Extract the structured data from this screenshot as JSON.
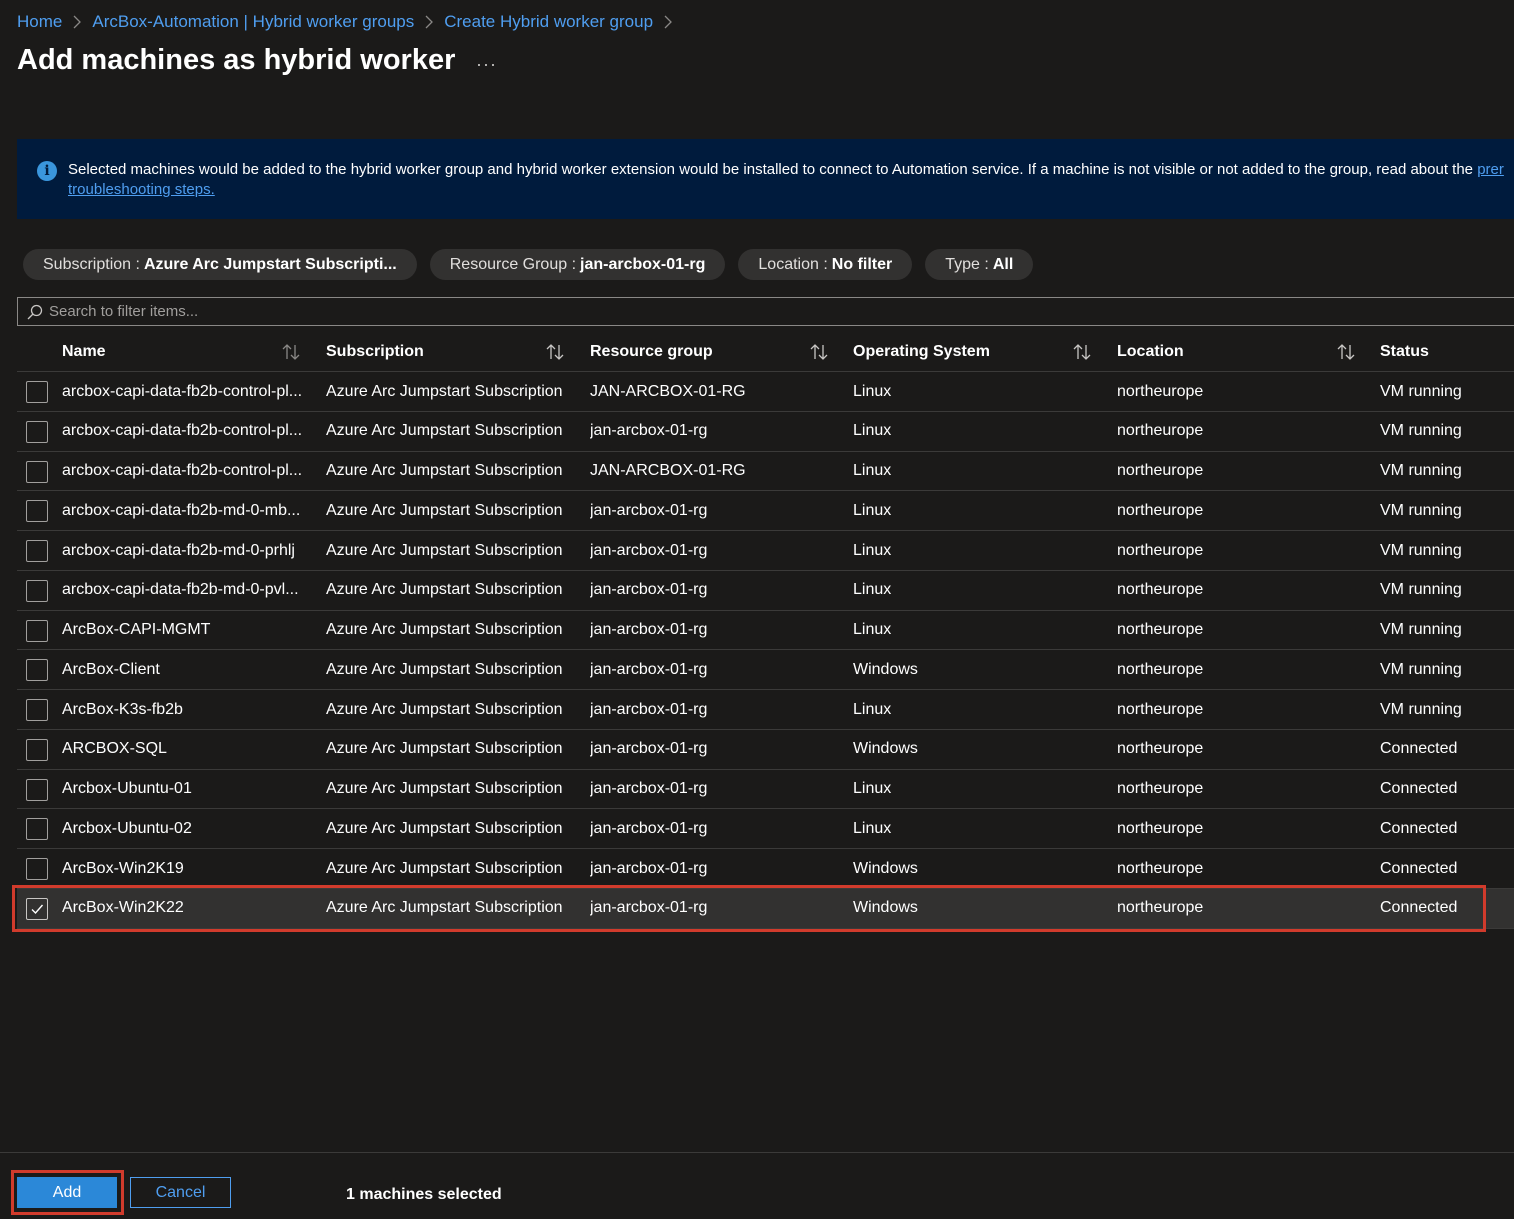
{
  "breadcrumb": [
    "Home",
    "ArcBox-Automation | Hybrid worker groups",
    "Create Hybrid worker group"
  ],
  "page": {
    "title": "Add machines as hybrid worker",
    "more": "···"
  },
  "info": {
    "text": "Selected machines would be added to the hybrid worker group and hybrid worker extension would be installed to connect to Automation service. If a machine is not visible or not added to the group, read about the ",
    "link_fragment": "prer",
    "link_line2": "troubleshooting steps."
  },
  "filters": [
    {
      "label": "Subscription :",
      "value": "Azure Arc Jumpstart Subscripti..."
    },
    {
      "label": "Resource Group :",
      "value": "jan-arcbox-01-rg"
    },
    {
      "label": "Location :",
      "value": "No filter"
    },
    {
      "label": "Type :",
      "value": "All"
    }
  ],
  "search": {
    "placeholder": "Search to filter items..."
  },
  "table": {
    "columns": [
      "Name",
      "Subscription",
      "Resource group",
      "Operating System",
      "Location",
      "Status"
    ],
    "rows": [
      {
        "name": "arcbox-capi-data-fb2b-control-pl...",
        "subscription": "Azure Arc Jumpstart Subscription",
        "resource_group": "JAN-ARCBOX-01-RG",
        "os": "Linux",
        "location": "northeurope",
        "status": "VM running",
        "checked": false
      },
      {
        "name": "arcbox-capi-data-fb2b-control-pl...",
        "subscription": "Azure Arc Jumpstart Subscription",
        "resource_group": "jan-arcbox-01-rg",
        "os": "Linux",
        "location": "northeurope",
        "status": "VM running",
        "checked": false
      },
      {
        "name": "arcbox-capi-data-fb2b-control-pl...",
        "subscription": "Azure Arc Jumpstart Subscription",
        "resource_group": "JAN-ARCBOX-01-RG",
        "os": "Linux",
        "location": "northeurope",
        "status": "VM running",
        "checked": false
      },
      {
        "name": "arcbox-capi-data-fb2b-md-0-mb...",
        "subscription": "Azure Arc Jumpstart Subscription",
        "resource_group": "jan-arcbox-01-rg",
        "os": "Linux",
        "location": "northeurope",
        "status": "VM running",
        "checked": false
      },
      {
        "name": "arcbox-capi-data-fb2b-md-0-prhlj",
        "subscription": "Azure Arc Jumpstart Subscription",
        "resource_group": "jan-arcbox-01-rg",
        "os": "Linux",
        "location": "northeurope",
        "status": "VM running",
        "checked": false
      },
      {
        "name": "arcbox-capi-data-fb2b-md-0-pvl...",
        "subscription": "Azure Arc Jumpstart Subscription",
        "resource_group": "jan-arcbox-01-rg",
        "os": "Linux",
        "location": "northeurope",
        "status": "VM running",
        "checked": false
      },
      {
        "name": "ArcBox-CAPI-MGMT",
        "subscription": "Azure Arc Jumpstart Subscription",
        "resource_group": "jan-arcbox-01-rg",
        "os": "Linux",
        "location": "northeurope",
        "status": "VM running",
        "checked": false
      },
      {
        "name": "ArcBox-Client",
        "subscription": "Azure Arc Jumpstart Subscription",
        "resource_group": "jan-arcbox-01-rg",
        "os": "Windows",
        "location": "northeurope",
        "status": "VM running",
        "checked": false
      },
      {
        "name": "ArcBox-K3s-fb2b",
        "subscription": "Azure Arc Jumpstart Subscription",
        "resource_group": "jan-arcbox-01-rg",
        "os": "Linux",
        "location": "northeurope",
        "status": "VM running",
        "checked": false
      },
      {
        "name": "ARCBOX-SQL",
        "subscription": "Azure Arc Jumpstart Subscription",
        "resource_group": "jan-arcbox-01-rg",
        "os": "Windows",
        "location": "northeurope",
        "status": "Connected",
        "checked": false
      },
      {
        "name": "Arcbox-Ubuntu-01",
        "subscription": "Azure Arc Jumpstart Subscription",
        "resource_group": "jan-arcbox-01-rg",
        "os": "Linux",
        "location": "northeurope",
        "status": "Connected",
        "checked": false
      },
      {
        "name": "Arcbox-Ubuntu-02",
        "subscription": "Azure Arc Jumpstart Subscription",
        "resource_group": "jan-arcbox-01-rg",
        "os": "Linux",
        "location": "northeurope",
        "status": "Connected",
        "checked": false
      },
      {
        "name": "ArcBox-Win2K19",
        "subscription": "Azure Arc Jumpstart Subscription",
        "resource_group": "jan-arcbox-01-rg",
        "os": "Windows",
        "location": "northeurope",
        "status": "Connected",
        "checked": false
      },
      {
        "name": "ArcBox-Win2K22",
        "subscription": "Azure Arc Jumpstart Subscription",
        "resource_group": "jan-arcbox-01-rg",
        "os": "Windows",
        "location": "northeurope",
        "status": "Connected",
        "checked": true
      }
    ]
  },
  "footer": {
    "add_label": "Add",
    "cancel_label": "Cancel",
    "selected_text": "1 machines selected"
  },
  "colors": {
    "accent": "#2b88d8",
    "link": "#4f9ef0",
    "highlight": "#d13b2c",
    "background": "#1b1a19",
    "info_bg": "#001b3d"
  }
}
